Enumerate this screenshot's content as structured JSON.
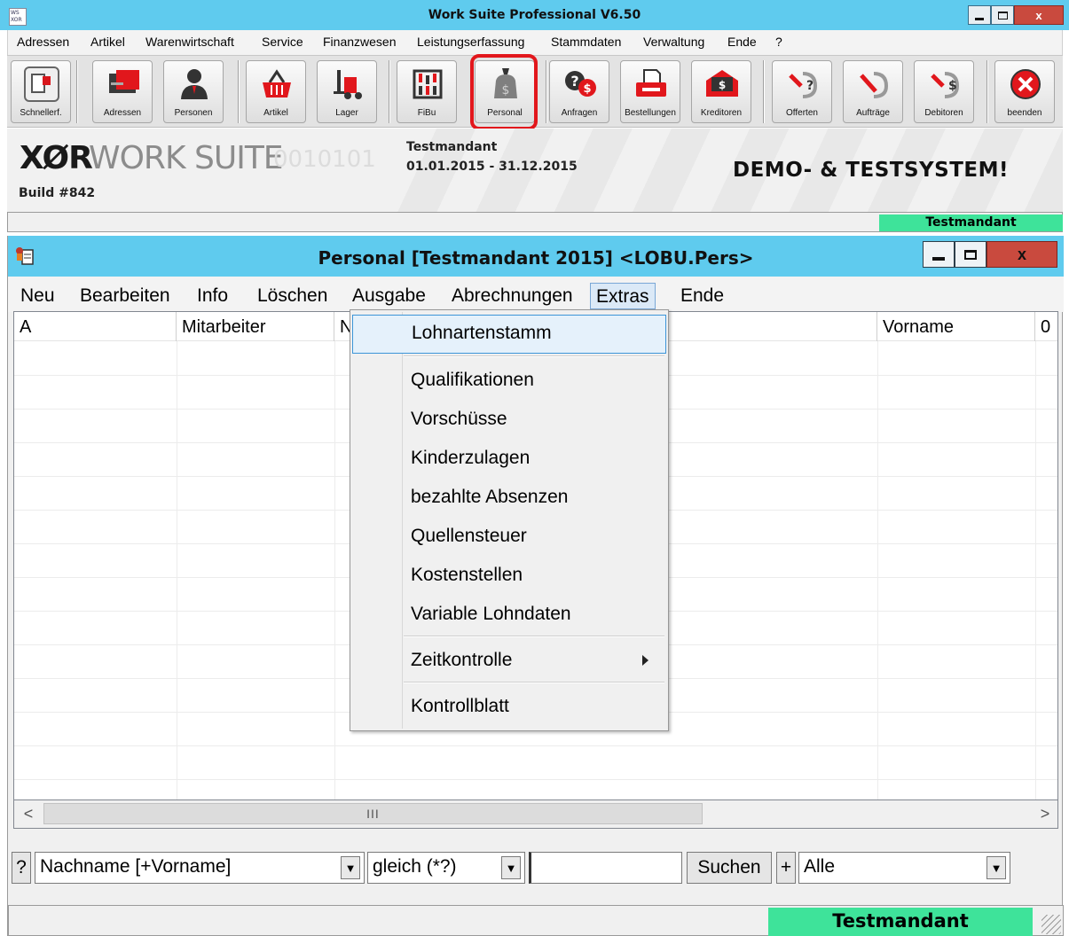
{
  "app": {
    "title": "Work Suite Professional V6.50",
    "icon_label": "WS XOR",
    "window_controls": {
      "minimize": "—",
      "maximize": "☐",
      "close": "x"
    },
    "menu": [
      "Adressen",
      "Artikel",
      "Warenwirtschaft",
      "Service",
      "Finanzwesen",
      "Leistungserfassung",
      "Stammdaten",
      "Verwaltung",
      "Ende",
      "?"
    ],
    "toolbar": [
      {
        "label": "Schnellerf.",
        "icon": "quick-entry-icon"
      },
      {
        "label": "Adressen",
        "icon": "address-card-icon"
      },
      {
        "label": "Personen",
        "icon": "person-icon"
      },
      {
        "label": "Artikel",
        "icon": "basket-icon"
      },
      {
        "label": "Lager",
        "icon": "forklift-icon"
      },
      {
        "label": "FiBu",
        "icon": "abacus-icon"
      },
      {
        "label": "Personal",
        "icon": "money-bag-icon",
        "highlighted": true
      },
      {
        "label": "Anfragen",
        "icon": "inquiry-icon"
      },
      {
        "label": "Bestellungen",
        "icon": "order-icon"
      },
      {
        "label": "Kreditoren",
        "icon": "creditor-icon"
      },
      {
        "label": "Offerten",
        "icon": "offer-icon"
      },
      {
        "label": "Aufträge",
        "icon": "job-icon"
      },
      {
        "label": "Debitoren",
        "icon": "debtor-icon"
      },
      {
        "label": "beenden",
        "icon": "exit-icon"
      }
    ],
    "banner": {
      "logo": "XØR",
      "suite": "WORK SUITE",
      "bits": "0010101",
      "build": "Build #842",
      "mandant": "Testmandant",
      "period": "01.01.2015 - 31.12.2015",
      "demo": "DEMO- & TESTSYSTEM!"
    },
    "status_right": "Testmandant"
  },
  "inner": {
    "title": "Personal [Testmandant 2015] <LOBU.Pers>",
    "window_controls": {
      "minimize": "—",
      "maximize": "☐",
      "close": "x"
    },
    "menu": [
      "Neu",
      "Bearbeiten",
      "Info",
      "Löschen",
      "Ausgabe",
      "Abrechnungen",
      "Extras",
      "Ende"
    ],
    "active_menu": "Extras",
    "columns": [
      "A",
      "Mitarbeiter",
      "N",
      "",
      "Vorname",
      "0"
    ],
    "scroll_thumb": "III",
    "scroll_left": "<",
    "scroll_right": ">",
    "search": {
      "help": "?",
      "field_value": "Nachname [+Vorname]",
      "operator_value": "gleich (*?)",
      "text_value": "",
      "search_button": "Suchen",
      "plus_button": "+",
      "filter_value": "Alle",
      "dropdown_arrow": "▼"
    },
    "status_right": "Testmandant"
  },
  "extras_menu": {
    "items": [
      {
        "label": "Lohnartenstamm",
        "highlighted": true
      },
      {
        "label": "Qualifikationen"
      },
      {
        "label": "Vorschüsse"
      },
      {
        "label": "Kinderzulagen"
      },
      {
        "label": "bezahlte Absenzen"
      },
      {
        "label": "Quellensteuer"
      },
      {
        "label": "Kostenstellen"
      },
      {
        "label": "Variable Lohndaten"
      },
      {
        "label": "Zeitkontrolle",
        "submenu": true
      },
      {
        "label": "Kontrollblatt"
      }
    ]
  },
  "colors": {
    "titlebar": "#5fcbee",
    "status_green": "#3ee39a",
    "close_red": "#c94a3e",
    "highlight_red": "#e2171c",
    "menu_highlight": "#e5f1fb"
  }
}
